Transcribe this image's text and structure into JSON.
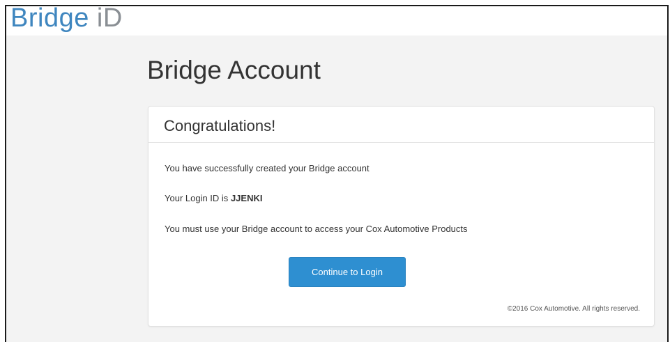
{
  "header": {
    "logo_brand": "Bridge",
    "logo_suffix": "iD"
  },
  "page": {
    "title": "Bridge Account"
  },
  "panel": {
    "heading": "Congratulations!",
    "message_created": "You have successfully created your Bridge account",
    "login_id_prefix": "Your Login ID is",
    "login_id": "JJENKI",
    "message_access": "You must use your Bridge account to access your Cox Automotive Products",
    "continue_label": "Continue to Login",
    "copyright": "©2016 Cox Automotive. All rights reserved."
  },
  "colors": {
    "brand_blue": "#3f86bf",
    "button_blue": "#2e8fd1",
    "background": "#f3f3f3"
  }
}
